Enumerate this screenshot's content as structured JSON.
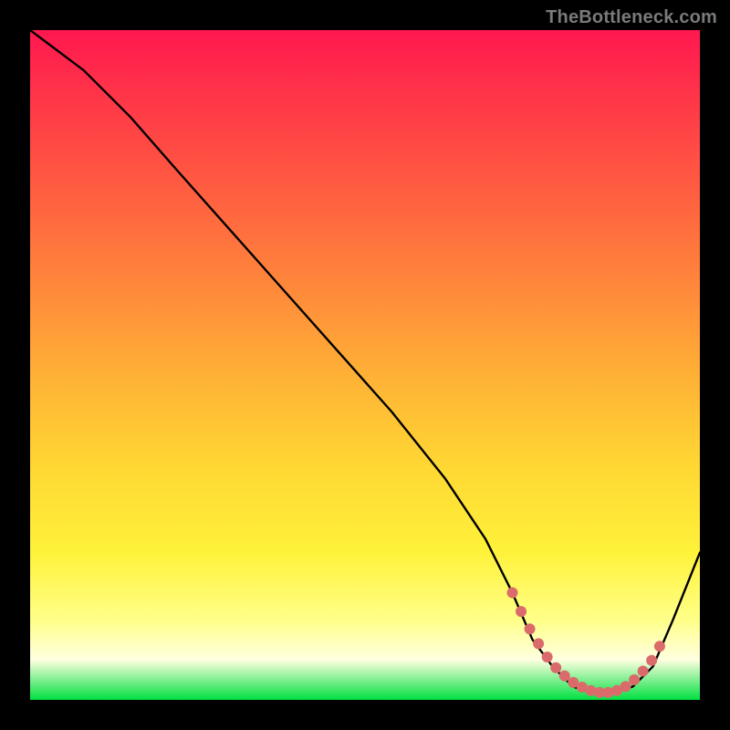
{
  "watermark": "TheBottleneck.com",
  "colors": {
    "page_bg": "#000000",
    "curve_stroke": "#000000",
    "marker_fill": "#db6b6b",
    "watermark_text": "#7a7a7a"
  },
  "chart_data": {
    "type": "line",
    "title": "",
    "xlabel": "",
    "ylabel": "",
    "xlim": [
      0,
      100
    ],
    "ylim": [
      0,
      100
    ],
    "grid": false,
    "legend": false,
    "series": [
      {
        "name": "curve",
        "x": [
          0,
          4,
          8,
          15,
          22,
          30,
          38,
          46,
          54,
          62,
          68,
          72,
          75,
          78,
          81,
          84,
          87,
          90,
          93,
          96,
          100
        ],
        "values": [
          100,
          97,
          94,
          87,
          79,
          70,
          61,
          52,
          43,
          33,
          24,
          16,
          9,
          5,
          2,
          1,
          1,
          2,
          5,
          12,
          22
        ]
      }
    ],
    "markers": {
      "name": "highlight",
      "x": [
        72,
        73.3,
        74.6,
        75.9,
        77.2,
        78.5,
        79.8,
        81.1,
        82.4,
        83.7,
        85,
        86.3,
        87.6,
        88.9,
        90.2,
        91.5,
        92.8,
        94
      ],
      "values": [
        16,
        13.2,
        10.6,
        8.4,
        6.4,
        4.8,
        3.6,
        2.6,
        1.9,
        1.4,
        1.1,
        1.1,
        1.4,
        2.0,
        3.0,
        4.3,
        5.9,
        8
      ]
    }
  }
}
